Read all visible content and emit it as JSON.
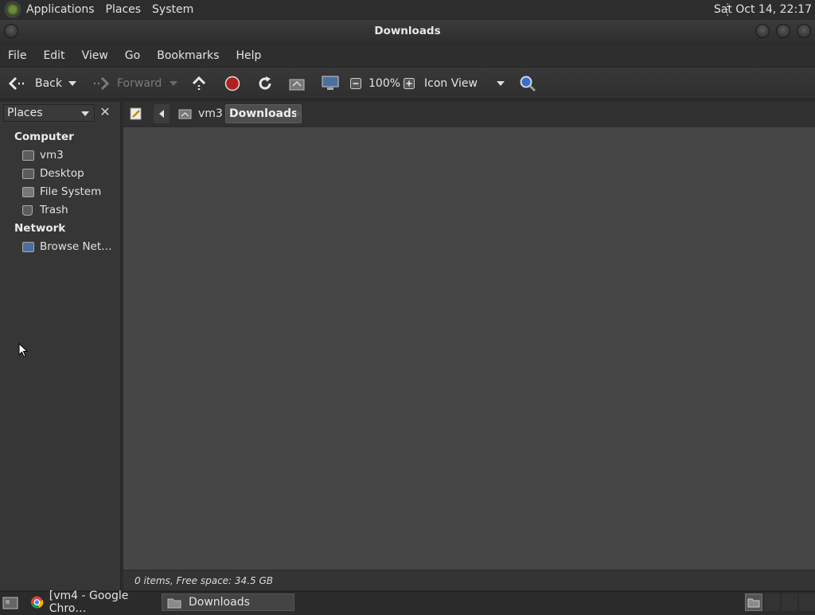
{
  "top_panel": {
    "menus": [
      "Applications",
      "Places",
      "System"
    ],
    "clock": "Sat Oct 14, 22:17"
  },
  "window": {
    "title": "Downloads",
    "menu": [
      "File",
      "Edit",
      "View",
      "Go",
      "Bookmarks",
      "Help"
    ],
    "toolbar": {
      "back_label": "Back",
      "forward_label": "Forward",
      "zoom_level": "100%",
      "view_mode": "Icon View"
    },
    "sidebar": {
      "selector": "Places",
      "sections": [
        {
          "title": "Computer",
          "items": [
            "vm3",
            "Desktop",
            "File System",
            "Trash"
          ]
        },
        {
          "title": "Network",
          "items": [
            "Browse Net…"
          ]
        }
      ]
    },
    "location": {
      "crumbs": [
        "vm3",
        "Downloads"
      ]
    },
    "status": "0 items, Free space: 34.5 GB"
  },
  "taskbar": {
    "tasks": [
      "[vm4 - Google Chro…",
      "Downloads"
    ]
  }
}
